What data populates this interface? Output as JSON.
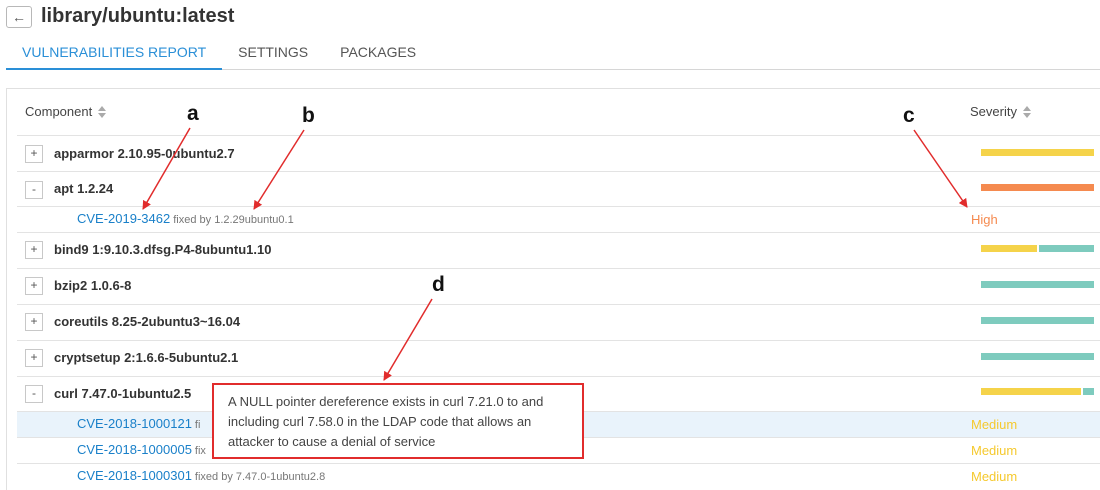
{
  "header": {
    "back_icon": "arrow-left-icon",
    "back_glyph": "←",
    "title": "library/ubuntu:latest"
  },
  "tabs": [
    {
      "label": "VULNERABILITIES REPORT",
      "active": true
    },
    {
      "label": "SETTINGS",
      "active": false
    },
    {
      "label": "PACKAGES",
      "active": false
    }
  ],
  "table": {
    "component_header": "Component",
    "severity_header": "Severity",
    "rows": [
      {
        "type": "component",
        "toggle": "+",
        "name": "apparmor 2.10.95-0ubuntu2.7"
      },
      {
        "type": "component",
        "toggle": "-",
        "name": "apt 1.2.24"
      },
      {
        "type": "cve",
        "id": "CVE-2019-3462",
        "fixed": "fixed by 1.2.29ubuntu0.1",
        "severity": "High"
      },
      {
        "type": "component",
        "toggle": "+",
        "name": "bind9 1:9.10.3.dfsg.P4-8ubuntu1.10"
      },
      {
        "type": "component",
        "toggle": "+",
        "name": "bzip2 1.0.6-8"
      },
      {
        "type": "component",
        "toggle": "+",
        "name": "coreutils 8.25-2ubuntu3~16.04"
      },
      {
        "type": "component",
        "toggle": "+",
        "name": "cryptsetup 2:1.6.6-5ubuntu2.1"
      },
      {
        "type": "component",
        "toggle": "-",
        "name": "curl 7.47.0-1ubuntu2.5"
      },
      {
        "type": "cve",
        "id": "CVE-2018-1000121",
        "fixed": "fi",
        "severity": "Medium"
      },
      {
        "type": "cve",
        "id": "CVE-2018-1000005",
        "fixed": "fix",
        "severity": "Medium"
      },
      {
        "type": "cve",
        "id": "CVE-2018-1000301",
        "fixed": "fixed by 7.47.0-1ubuntu2.8",
        "severity": "Medium"
      }
    ]
  },
  "severity_bars": {
    "apparmor": [
      {
        "color": "#f5d34a",
        "fraction": 1.0
      }
    ],
    "apt": [
      {
        "color": "#f58a4f",
        "fraction": 1.0
      }
    ],
    "bind9": [
      {
        "color": "#f5d34a",
        "fraction": 0.5
      },
      {
        "color": "#7ecbbe",
        "fraction": 0.5
      }
    ],
    "bzip2": [
      {
        "color": "#7ecbbe",
        "fraction": 1.0
      }
    ],
    "coreutils": [
      {
        "color": "#7ecbbe",
        "fraction": 1.0
      }
    ],
    "cryptsetup": [
      {
        "color": "#7ecbbe",
        "fraction": 1.0
      }
    ],
    "curl": [
      {
        "color": "#f5d34a",
        "fraction": 0.9
      },
      {
        "color": "#7ecbbe",
        "fraction": 0.1
      }
    ]
  },
  "severity_colors": {
    "High": "#f58a4f",
    "Medium": "#f5c92e"
  },
  "tooltip": {
    "line1": "A NULL pointer dereference exists in curl 7.21.0 to and",
    "line2": "including curl 7.58.0 in the LDAP code that allows an",
    "line3": "attacker to cause a denial of service"
  },
  "annotations": {
    "a": "a",
    "b": "b",
    "c": "c",
    "d": "d"
  },
  "annotation_color": "#e12c2c"
}
